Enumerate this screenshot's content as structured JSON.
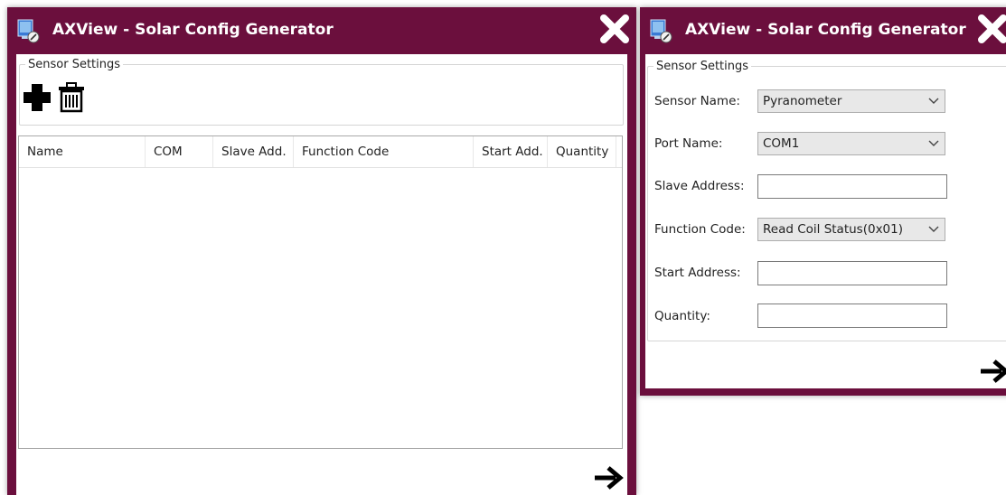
{
  "left_window": {
    "title": "AXView - Solar Config Generator",
    "group_label": "Sensor Settings",
    "table": {
      "columns": [
        "Name",
        "COM",
        "Slave Add.",
        "Function Code",
        "Start Add.",
        "Quantity"
      ],
      "rows": []
    }
  },
  "right_window": {
    "title": "AXView - Solar Config Generator",
    "group_label": "Sensor Settings",
    "fields": {
      "sensor_name": {
        "label": "Sensor Name:",
        "value": "Pyranometer"
      },
      "port_name": {
        "label": "Port Name:",
        "value": "COM1"
      },
      "slave_address": {
        "label": "Slave Address:",
        "value": ""
      },
      "function_code": {
        "label": "Function Code:",
        "value": "Read Coil Status(0x01)"
      },
      "start_address": {
        "label": "Start Address:",
        "value": ""
      },
      "quantity": {
        "label": "Quantity:",
        "value": ""
      }
    }
  },
  "theme": {
    "titlebar_color": "#6b0f3d",
    "title_text_color": "#ffffff",
    "combo_bg": "#e8e8e8"
  },
  "icons": {
    "app": "monitor-pen-icon",
    "close": "close-x-icon",
    "add": "plus-icon",
    "delete": "trash-icon",
    "next": "arrow-right-icon",
    "dropdown": "chevron-down-icon"
  }
}
